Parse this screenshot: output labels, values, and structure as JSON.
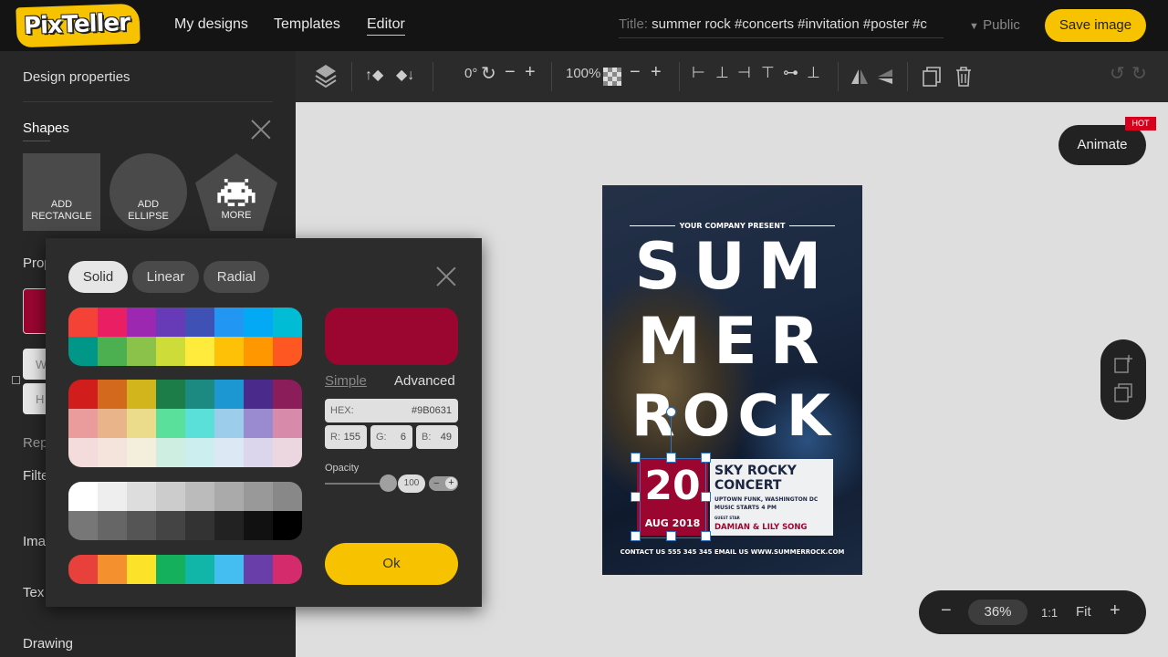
{
  "app": {
    "logo": "PixTeller"
  },
  "nav": {
    "my_designs": "My designs",
    "templates": "Templates",
    "editor": "Editor"
  },
  "title_field": {
    "label": "Title:",
    "value": "summer rock #concerts #invitation #poster #c"
  },
  "visibility": "Public",
  "save_button": "Save image",
  "left_panel": {
    "design_properties": "Design properties",
    "shapes_title": "Shapes",
    "shapes": [
      {
        "label1": "ADD",
        "label2": "RECTANGLE"
      },
      {
        "label1": "ADD",
        "label2": "ELLIPSE"
      },
      {
        "label1": "",
        "label2": "MORE"
      }
    ],
    "properties_partial": "Prop",
    "width_partial": "W",
    "height_partial": "H",
    "repeat_partial": "Rep",
    "filter_partial": "Filte",
    "image_partial": "Ima",
    "text_partial": "Tex",
    "drawing": "Drawing"
  },
  "toolbar": {
    "rotation": "0°",
    "zoom": "100%"
  },
  "canvas": {
    "animate_button": "Animate",
    "hot_badge": "HOT",
    "zoom_level": "36%",
    "ratio_button": "1:1",
    "fit_button": "Fit"
  },
  "poster": {
    "company": "YOUR COMPANY PRESENT",
    "line1": "SUM",
    "line2": "MER",
    "line3": "ROCK",
    "day": "20",
    "month_year": "AUG 2018",
    "event_title_1": "SKY ROCKY",
    "event_title_2": "CONCERT",
    "subtitle_1": "UPTOWN FUNK, WASHINGTON DC",
    "subtitle_2": "MUSIC STARTS 4 PM",
    "guest_label": "GUEST STAR",
    "guests": "DAMIAN & LILY SONG",
    "contact": "CONTACT US 555 345 345 EMAIL US WWW.SUMMERROCK.COM"
  },
  "color_picker": {
    "modes": [
      "Solid",
      "Linear",
      "Radial"
    ],
    "simple_tab": "Simple",
    "advanced_tab": "Advanced",
    "hex_label": "HEX:",
    "hex_value": "#9B0631",
    "r_label": "R:",
    "r_value": "155",
    "g_label": "G:",
    "g_value": "6",
    "b_label": "B:",
    "b_value": "49",
    "opacity_label": "Opacity",
    "opacity_value": "100",
    "ok_button": "Ok",
    "selected_color": "#9b0631",
    "palette_1": [
      "#f44336",
      "#e91e63",
      "#9c27b0",
      "#673ab7",
      "#3f51b5",
      "#2196f3",
      "#03a9f4",
      "#00bcd4",
      "#009688",
      "#4caf50",
      "#8bc34a",
      "#cddc39",
      "#ffeb3b",
      "#ffc107",
      "#ff9800",
      "#ff5722"
    ],
    "palette_2": [
      "#d21d1d",
      "#d2691d",
      "#d2b41d",
      "#1d7d49",
      "#1d8a82",
      "#1d97d2",
      "#4a2a8a",
      "#8a1d5a",
      "#ea9c9c",
      "#eab48a",
      "#eadc8a",
      "#5ae09a",
      "#5ae0d8",
      "#9ccdea",
      "#9a8ad0",
      "#d88aaa",
      "#f4dcdc",
      "#f4e4dc",
      "#f4eedc",
      "#cdeee0",
      "#cdeeee",
      "#dce8f4",
      "#dcd6ec",
      "#ecd6e0"
    ],
    "palette_3": [
      "#ffffff",
      "#eeeeee",
      "#dddddd",
      "#cccccc",
      "#bbbbbb",
      "#aaaaaa",
      "#999999",
      "#888888",
      "#777777",
      "#666666",
      "#555555",
      "#444444",
      "#333333",
      "#222222",
      "#111111",
      "#000000"
    ],
    "palette_4": [
      "#e8403a",
      "#f5902f",
      "#fde22a",
      "#14b05c",
      "#12b6a8",
      "#44bdf0",
      "#6a3ea8",
      "#d32b6c"
    ]
  }
}
